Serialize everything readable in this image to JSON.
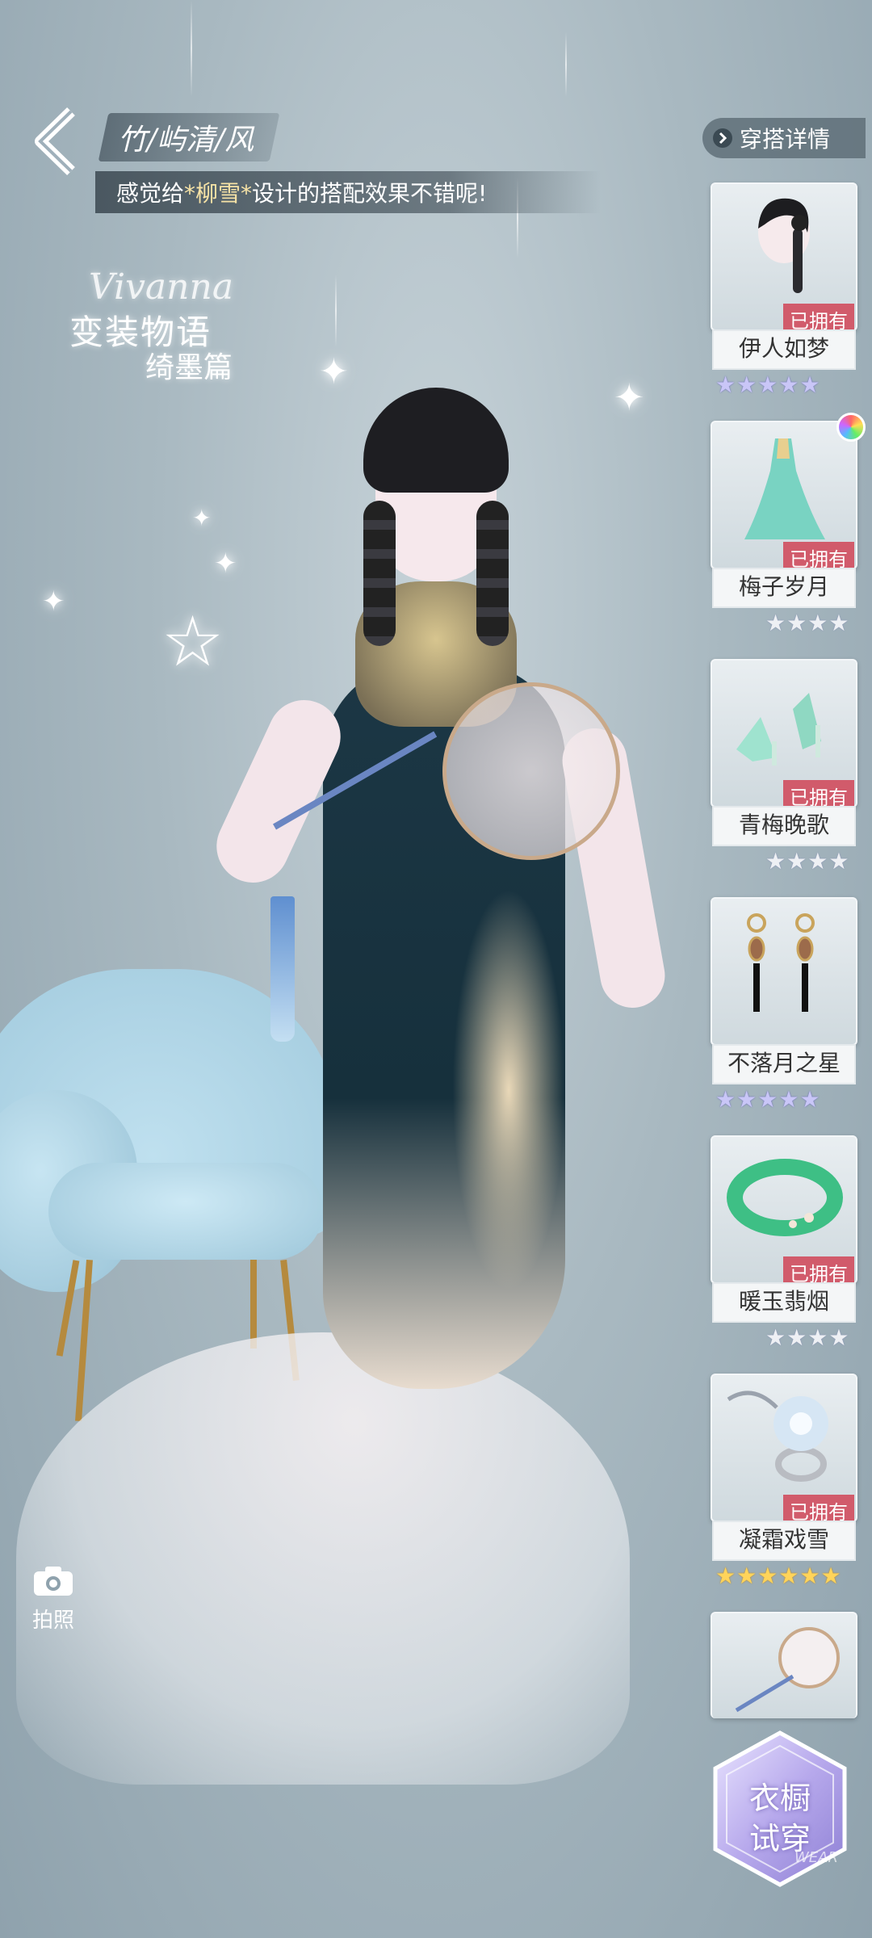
{
  "header": {
    "title": "竹/屿清/风",
    "subtitle_prefix": "感觉给",
    "subtitle_highlight": "*柳雪*",
    "subtitle_suffix": "设计的搭配效果不错呢!"
  },
  "logo": {
    "script": "Vivanna",
    "line1": "变装物语",
    "line2": "绮墨篇"
  },
  "detail_button": {
    "label": "穿搭详情",
    "icon": "chevron-right-icon"
  },
  "outfit_items": [
    {
      "name": "伊人如梦",
      "owned_label": "已拥有",
      "stars": 5,
      "star_color": "purple",
      "category_icon": "hair-icon"
    },
    {
      "name": "梅子岁月",
      "owned_label": "已拥有",
      "stars": 4,
      "star_color": "gray",
      "category_icon": "dress-icon"
    },
    {
      "name": "青梅晚歌",
      "owned_label": "已拥有",
      "stars": 4,
      "star_color": "gray",
      "category_icon": "shoes-icon"
    },
    {
      "name": "不落月之星",
      "owned_label": "",
      "stars": 5,
      "star_color": "purple",
      "category_icon": "earrings-icon"
    },
    {
      "name": "暖玉翡烟",
      "owned_label": "已拥有",
      "stars": 4,
      "star_color": "gray",
      "category_icon": "bracelet-icon"
    },
    {
      "name": "凝霜戏雪",
      "owned_label": "已拥有",
      "stars": 6,
      "star_color": "gold",
      "category_icon": "ring-icon"
    }
  ],
  "camera": {
    "label": "拍照",
    "icon": "camera-icon"
  },
  "tryon": {
    "line1": "衣橱",
    "line2": "试穿",
    "watermark": "WEAR"
  },
  "colors": {
    "owned_badge": "#d15b6b",
    "highlight_text": "#f7e3a6",
    "star_gold": "#ffd45a",
    "star_purple": "#c9c6f7"
  }
}
